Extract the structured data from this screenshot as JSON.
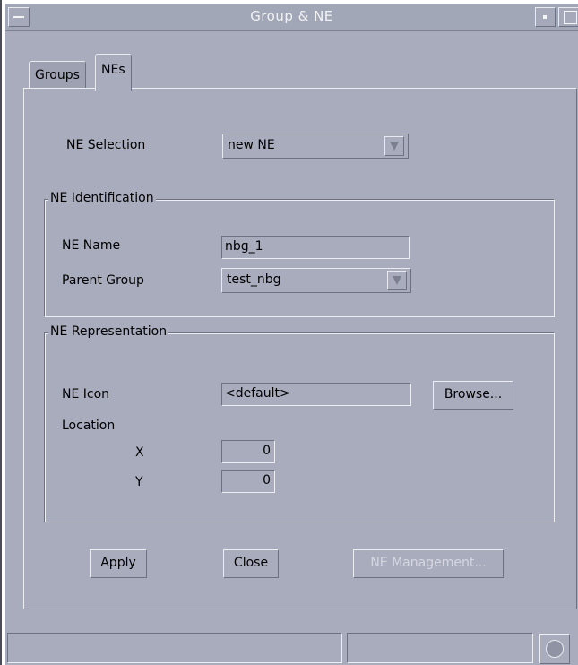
{
  "window": {
    "title": "Group & NE"
  },
  "tabs": [
    {
      "label": "Groups",
      "active": false
    },
    {
      "label": "NEs",
      "active": true
    }
  ],
  "ne_selection": {
    "label": "NE Selection",
    "value": "new NE"
  },
  "ne_identification": {
    "legend": "NE Identification",
    "ne_name_label": "NE Name",
    "ne_name_value": "nbg_1",
    "parent_group_label": "Parent Group",
    "parent_group_value": "test_nbg"
  },
  "ne_representation": {
    "legend": "NE Representation",
    "ne_icon_label": "NE Icon",
    "ne_icon_value": "<default>",
    "browse_label": "Browse...",
    "location_label": "Location",
    "x_label": "X",
    "x_value": "0",
    "y_label": "Y",
    "y_value": "0"
  },
  "actions": {
    "apply_label": "Apply",
    "close_label": "Close",
    "ne_management_label": "NE Management..."
  },
  "icons": {
    "window_menu": "window-menu-icon",
    "minimize": "minimize-icon",
    "maximize": "maximize-icon",
    "dropdown_arrow": "dropdown-arrow-icon",
    "status": "status-indicator-icon"
  },
  "colors": {
    "background": "#a8acbd",
    "title_text": "#f2f2f2",
    "disabled_text": "#d5d7e0"
  }
}
